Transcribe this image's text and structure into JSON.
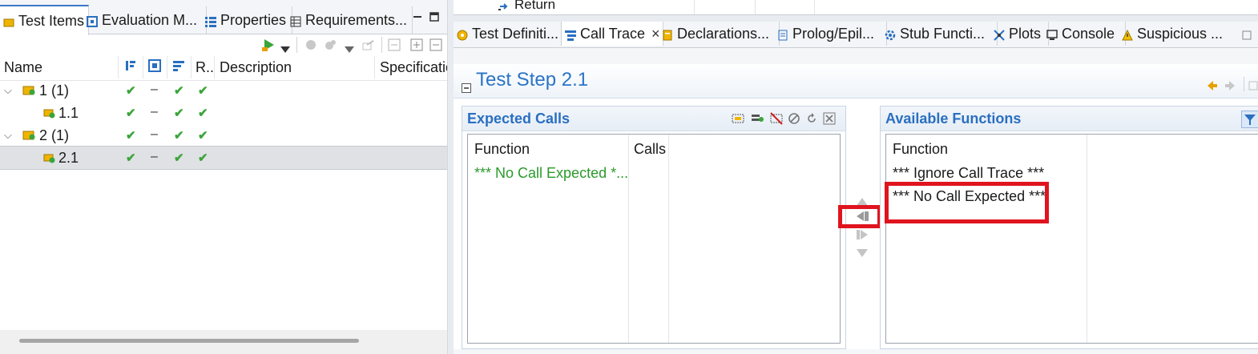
{
  "left_panel": {
    "tabs": [
      {
        "label": "Test Items",
        "icon": "test-items-icon"
      },
      {
        "label": "Evaluation M...",
        "icon": "evaluation-icon"
      },
      {
        "label": "Properties",
        "icon": "properties-icon"
      },
      {
        "label": "Requirements...",
        "icon": "requirements-icon"
      }
    ],
    "columns": {
      "name": "Name",
      "r": "R..",
      "description": "Description",
      "specification": "Specificatio"
    },
    "rows": [
      {
        "label": "1 (1)",
        "expanded": true,
        "selected": false
      },
      {
        "label": "1.1",
        "expanded": false,
        "selected": false
      },
      {
        "label": "2 (1)",
        "expanded": true,
        "selected": false
      },
      {
        "label": "2.1",
        "expanded": false,
        "selected": true
      }
    ],
    "marks": {
      "check": "✔",
      "dash": "–"
    }
  },
  "top_strip": {
    "return_label": "Return"
  },
  "right_panel": {
    "tabs": [
      {
        "label": "Test Definiti...",
        "icon": "test-definition-icon",
        "active": false
      },
      {
        "label": "Call Trace",
        "icon": "call-trace-icon",
        "active": true,
        "close": "×"
      },
      {
        "label": "Declarations...",
        "icon": "declarations-icon",
        "active": false
      },
      {
        "label": "Prolog/Epil...",
        "icon": "prolog-icon",
        "active": false
      },
      {
        "label": "Stub Functi...",
        "icon": "stub-functions-icon",
        "active": false
      },
      {
        "label": "Plots",
        "icon": "plots-icon",
        "active": false
      },
      {
        "label": "Console",
        "icon": "console-icon",
        "active": false
      },
      {
        "label": "Suspicious ...",
        "icon": "warning-icon",
        "active": false
      }
    ],
    "section_title": "Test Step 2.1",
    "expected_calls": {
      "title": "Expected Calls",
      "col_function": "Function",
      "col_calls": "Calls",
      "rows": [
        "*** No Call Expected *..."
      ]
    },
    "available_functions": {
      "title": "Available Functions",
      "col_function": "Function",
      "rows": [
        "*** Ignore Call Trace ***",
        "*** No Call Expected ***"
      ]
    }
  },
  "colors": {
    "accent": "#2a74c8",
    "check": "#3aa53a",
    "highlight": "#e0141e",
    "selection": "#dfe1e4"
  }
}
